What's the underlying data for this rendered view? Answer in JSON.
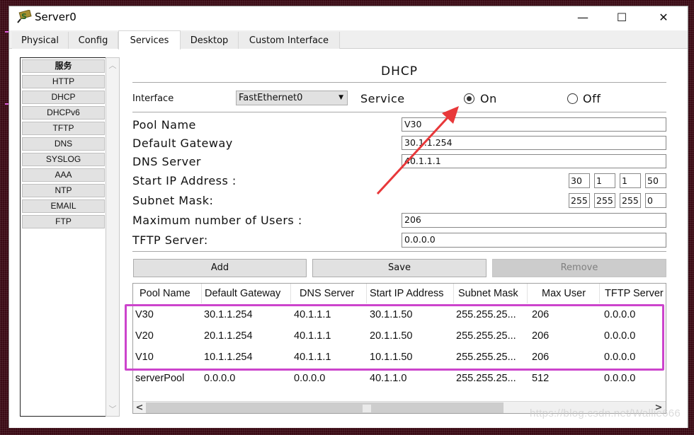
{
  "window": {
    "title": "Server0",
    "controls": {
      "minimize": "—",
      "maximize": "☐",
      "close": "✕"
    }
  },
  "tabs": [
    {
      "label": "Physical",
      "active": false
    },
    {
      "label": "Config",
      "active": false
    },
    {
      "label": "Services",
      "active": true
    },
    {
      "label": "Desktop",
      "active": false
    },
    {
      "label": "Custom Interface",
      "active": false
    }
  ],
  "services": {
    "header": "服务",
    "items": [
      "HTTP",
      "DHCP",
      "DHCPv6",
      "TFTP",
      "DNS",
      "SYSLOG",
      "AAA",
      "NTP",
      "EMAIL",
      "FTP"
    ]
  },
  "dhcp": {
    "title": "DHCP",
    "interface_label": "Interface",
    "interface_value": "FastEthernet0",
    "service_label": "Service",
    "service_on_label": "On",
    "service_off_label": "Off",
    "service_state": "On",
    "fields": {
      "pool_name_label": "Pool Name",
      "pool_name_value": "V30",
      "gateway_label": "Default Gateway",
      "gateway_value": "30.1.1.254",
      "dns_label": "DNS Server",
      "dns_value": "40.1.1.1",
      "start_ip_label": "Start IP Address :",
      "start_ip": [
        "30",
        "1",
        "1",
        "50"
      ],
      "subnet_label": "Subnet Mask:",
      "subnet": [
        "255",
        "255",
        "255",
        "0"
      ],
      "max_users_label": "Maximum number of Users :",
      "max_users_value": "206",
      "tftp_label": "TFTP Server:",
      "tftp_value": "0.0.0.0"
    },
    "buttons": {
      "add": "Add",
      "save": "Save",
      "remove": "Remove"
    },
    "table": {
      "columns": [
        "Pool Name",
        "Default Gateway",
        "DNS Server",
        "Start IP Address",
        "Subnet Mask",
        "Max User",
        "TFTP Server"
      ],
      "rows": [
        [
          "V30",
          "30.1.1.254",
          "40.1.1.1",
          "30.1.1.50",
          "255.255.25...",
          "206",
          "0.0.0.0"
        ],
        [
          "V20",
          "20.1.1.254",
          "40.1.1.1",
          "20.1.1.50",
          "255.255.25...",
          "206",
          "0.0.0.0"
        ],
        [
          "V10",
          "10.1.1.254",
          "40.1.1.1",
          "10.1.1.50",
          "255.255.25...",
          "206",
          "0.0.0.0"
        ],
        [
          "serverPool",
          "0.0.0.0",
          "0.0.0.0",
          "40.1.1.0",
          "255.255.25...",
          "512",
          "0.0.0.0"
        ]
      ]
    }
  },
  "annotation": {
    "highlight_color": "#cc44cc",
    "arrow_color": "#e8383a"
  },
  "watermark": "https://blog.csdn.net/Wallie666"
}
